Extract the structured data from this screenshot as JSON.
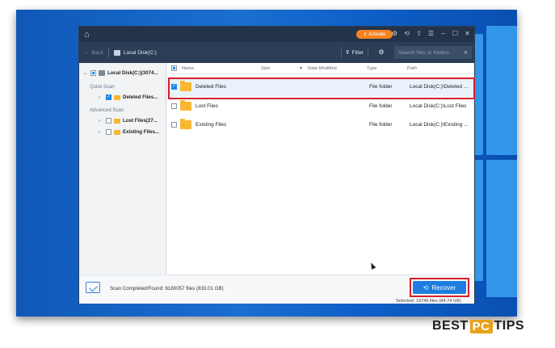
{
  "titlebar": {
    "activate_label": "Activate"
  },
  "toolbar": {
    "back_label": "Back",
    "location": "Local Disk(C:)",
    "filter_label": "Filter",
    "search_placeholder": "Search files or folders"
  },
  "sidebar": {
    "root_label": "Local Disk(C:)(3074...",
    "quick_scan_label": "Quick Scan",
    "deleted_files_label": "Deleted Files...",
    "advanced_scan_label": "Advanced Scan",
    "lost_files_label": "Lost Files(27...",
    "existing_files_label": "Existing Files..."
  },
  "columns": {
    "name": "Name",
    "size": "Size",
    "date_modified": "Date Modified",
    "type": "Type",
    "path": "Path"
  },
  "rows": [
    {
      "name": "Deleted Files",
      "type": "File folder",
      "path": "Local Disk(C:)\\Deleted ..."
    },
    {
      "name": "Lost Files",
      "type": "File folder",
      "path": "Local Disk(C:)\\Lost Files"
    },
    {
      "name": "Existing Files",
      "type": "File folder",
      "path": "Local Disk(C:)\\Existing ..."
    }
  ],
  "status": {
    "scan_text": "Scan Completed/Found: 6180057 files (833.01 GB)",
    "recover_label": "Recover",
    "selected_text": "Selected: 19746 files (84.74 GB)"
  },
  "brand": {
    "word1": "BEST",
    "word2": "PC",
    "word3": "TIPS"
  },
  "colors": {
    "accent": "#1e7ee0",
    "highlight": "#d81f2a",
    "activate": "#f58220",
    "titlebar": "#23344a"
  }
}
